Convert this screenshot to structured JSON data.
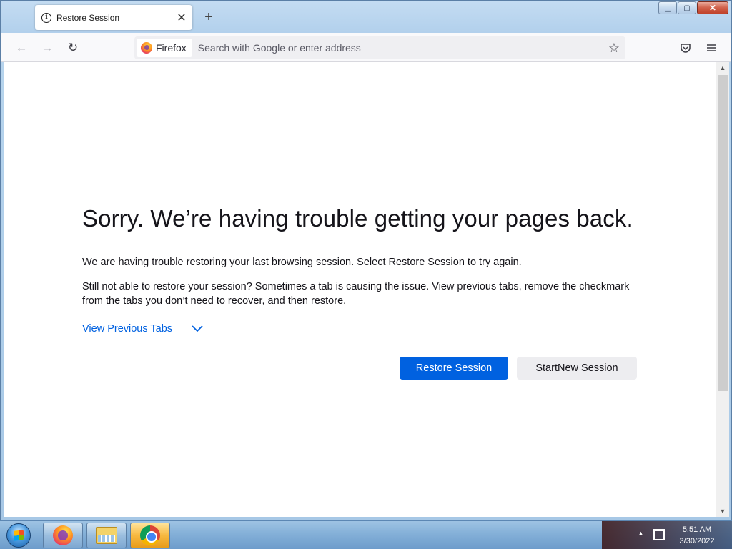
{
  "browser": {
    "tab": {
      "title": "Restore Session",
      "close_glyph": "✕"
    },
    "new_tab_glyph": "+",
    "window_controls": {
      "minimize": "▁",
      "maximize": "▢",
      "close": "✕"
    },
    "navbar": {
      "back_glyph": "←",
      "forward_glyph": "→",
      "reload_glyph": "↻",
      "identity_label": "Firefox",
      "url_placeholder": "Search with Google or enter address",
      "bookmark_glyph": "☆"
    }
  },
  "page": {
    "heading": "Sorry. We’re having trouble getting your pages back.",
    "paragraph1": "We are having trouble restoring your last browsing session. Select Restore Session to try again.",
    "paragraph2": "Still not able to restore your session? Sometimes a tab is causing the issue. View previous tabs, remove the checkmark from the tabs you don’t need to recover, and then restore.",
    "view_previous_tabs": "View Previous Tabs",
    "restore_button": {
      "access_key": "R",
      "rest": "estore Session"
    },
    "new_session_button": {
      "before": "Start ",
      "access_key": "N",
      "after": "ew Session"
    },
    "colors": {
      "primary": "#0061e0",
      "link": "#0061e0",
      "secondary_button": "#ededf0"
    }
  },
  "taskbar": {
    "apps": [
      "firefox-icon",
      "explorer-icon",
      "chrome-icon"
    ],
    "tray_arrow": "▲",
    "clock": {
      "time": "5:51 AM",
      "date": "3/30/2022"
    }
  }
}
